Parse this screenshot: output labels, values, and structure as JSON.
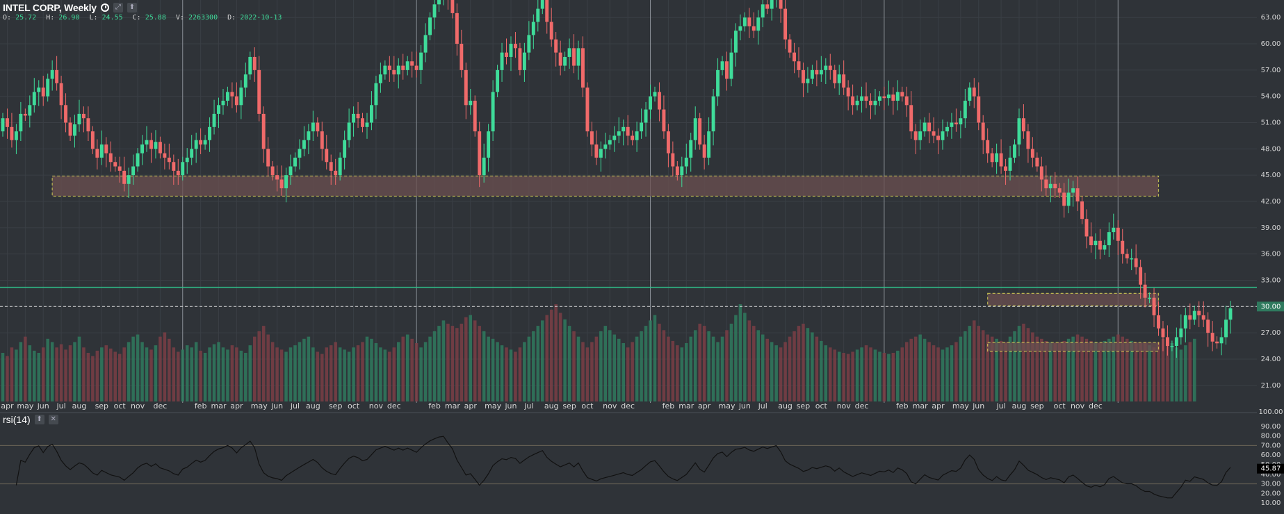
{
  "header": {
    "title": "INTEL CORP, Weekly",
    "ohlc": [
      {
        "label": "O:",
        "value": "25.72"
      },
      {
        "label": "H:",
        "value": "26.90"
      },
      {
        "label": "L:",
        "value": "24.55"
      },
      {
        "label": "C:",
        "value": "25.88"
      },
      {
        "label": "V:",
        "value": "2263300"
      },
      {
        "label": "D:",
        "value": "2022-10-13"
      }
    ],
    "expand_icon": "expand-icon",
    "up_icon": "arrow-up-icon"
  },
  "rsi_header": {
    "title": "rsi(14)",
    "up_icon": "arrow-up-icon",
    "close_icon": "close-icon"
  },
  "colors": {
    "up": "#3fdc9a",
    "down": "#f06a6a",
    "bg": "#2f3338",
    "grid": "#3a3f45",
    "zone": "#6b5050",
    "zone_border": "#e8e05a",
    "hline": "#2fbf8a",
    "rsi_line": "#111111"
  },
  "chart_data": {
    "type": "candlestick",
    "interval": "Weekly",
    "y_ticks": [
      "63.00",
      "60.00",
      "57.00",
      "54.00",
      "51.00",
      "48.00",
      "45.00",
      "42.00",
      "39.00",
      "36.00",
      "33.00",
      "30.00",
      "27.00",
      "24.00",
      "21.00"
    ],
    "y_ticks_values": [
      63,
      60,
      57,
      54,
      51,
      48,
      45,
      42,
      39,
      36,
      33,
      30,
      27,
      24,
      21
    ],
    "ylim": [
      19,
      65
    ],
    "price_marker": "30.00",
    "x_labels": [
      "apr",
      "may",
      "jun",
      "jul",
      "aug",
      "sep",
      "oct",
      "nov",
      "dec",
      "feb",
      "mar",
      "apr",
      "may",
      "jun",
      "jul",
      "aug",
      "sep",
      "oct",
      "nov",
      "dec",
      "feb",
      "mar",
      "apr",
      "may",
      "jun",
      "jul",
      "aug",
      "sep",
      "oct",
      "nov",
      "dec",
      "feb",
      "mar",
      "apr",
      "may",
      "jun",
      "jul",
      "aug",
      "sep",
      "oct",
      "nov",
      "dec",
      "feb",
      "mar",
      "apr",
      "may",
      "jun",
      "jul",
      "aug",
      "sep",
      "oct",
      "nov",
      "dec"
    ],
    "x_label_index": [
      1,
      5,
      9,
      13,
      17,
      22,
      26,
      30,
      35,
      44,
      48,
      52,
      57,
      61,
      65,
      69,
      74,
      78,
      83,
      87,
      96,
      100,
      104,
      109,
      113,
      117,
      122,
      126,
      130,
      135,
      139,
      148,
      152,
      156,
      161,
      165,
      169,
      174,
      178,
      182,
      187,
      191,
      200,
      204,
      208,
      213,
      217,
      222,
      226,
      230,
      235,
      239,
      243
    ],
    "year_separators": [
      40,
      92,
      144,
      196,
      248
    ],
    "support_zones": [
      {
        "low": 42.6,
        "high": 44.9
      },
      {
        "low": 30.1,
        "high": 31.5
      },
      {
        "low": 24.9,
        "high": 25.9
      }
    ],
    "zone_ranges": [
      [
        11,
        257
      ],
      [
        219,
        257
      ],
      [
        219,
        257
      ]
    ],
    "horizontal_line": 32.2,
    "dashed_line": 30.0,
    "closes": [
      51.5,
      50.5,
      49.0,
      50.0,
      52.0,
      51.8,
      53.0,
      54.5,
      55.0,
      54.0,
      56.0,
      57.0,
      55.5,
      53.0,
      51.0,
      49.5,
      50.8,
      52.0,
      51.5,
      50.0,
      48.0,
      47.0,
      48.5,
      47.5,
      46.5,
      46.0,
      45.5,
      44.0,
      45.0,
      46.0,
      47.5,
      48.5,
      49.0,
      48.0,
      48.8,
      47.5,
      47.0,
      46.5,
      45.5,
      45.0,
      46.5,
      47.0,
      48.0,
      49.0,
      48.5,
      49.0,
      50.5,
      52.0,
      53.0,
      53.5,
      54.5,
      54.0,
      53.0,
      55.0,
      56.5,
      58.5,
      57.0,
      52.0,
      48.0,
      46.0,
      45.0,
      44.5,
      43.5,
      45.0,
      46.0,
      47.0,
      48.0,
      49.0,
      50.0,
      51.0,
      50.0,
      48.0,
      46.5,
      45.5,
      45.0,
      47.0,
      49.0,
      51.0,
      52.0,
      51.5,
      50.5,
      51.0,
      53.0,
      55.5,
      56.5,
      57.5,
      57.0,
      56.5,
      57.5,
      57.0,
      58.0,
      57.5,
      57.0,
      59.0,
      61.0,
      63.0,
      64.5,
      66.0,
      66.5,
      65.0,
      63.5,
      60.0,
      57.0,
      53.0,
      53.5,
      50.0,
      45.0,
      47.0,
      50.0,
      54.5,
      57.0,
      59.0,
      58.5,
      60.0,
      59.5,
      57.0,
      59.0,
      61.0,
      62.5,
      64.0,
      65.5,
      62.5,
      60.5,
      59.0,
      57.5,
      58.5,
      59.5,
      57.5,
      59.5,
      55.0,
      50.0,
      48.5,
      47.0,
      48.0,
      48.5,
      49.0,
      49.5,
      50.0,
      50.5,
      49.5,
      49.0,
      50.0,
      51.0,
      52.5,
      54.0,
      54.5,
      52.5,
      50.0,
      47.5,
      46.0,
      45.0,
      46.0,
      47.0,
      49.0,
      51.5,
      48.5,
      47.0,
      50.0,
      54.0,
      57.0,
      58.0,
      56.0,
      59.0,
      61.5,
      62.0,
      63.0,
      62.0,
      61.5,
      63.0,
      64.5,
      64.0,
      65.0,
      66.0,
      64.0,
      60.5,
      59.0,
      58.0,
      57.0,
      55.5,
      56.0,
      57.0,
      56.5,
      57.0,
      57.5,
      57.0,
      55.5,
      56.5,
      55.0,
      54.0,
      53.0,
      53.5,
      54.0,
      53.5,
      53.0,
      53.5,
      54.0,
      53.8,
      54.2,
      53.5,
      54.5,
      54.0,
      53.0,
      50.0,
      49.0,
      50.0,
      51.0,
      50.0,
      49.5,
      49.0,
      50.0,
      50.5,
      51.0,
      50.8,
      51.5,
      53.5,
      55.0,
      54.0,
      51.0,
      49.0,
      47.5,
      46.5,
      47.5,
      46.0,
      45.5,
      47.0,
      48.5,
      51.5,
      50.0,
      48.0,
      47.0,
      46.0,
      44.5,
      43.5,
      44.0,
      43.5,
      43.0,
      41.5,
      43.0,
      43.5,
      42.0,
      40.0,
      38.0,
      37.0,
      37.5,
      36.5,
      37.0,
      38.5,
      39.0,
      37.5,
      36.0,
      35.5,
      35.5,
      34.5,
      32.5,
      31.0,
      31.0,
      29.0,
      27.5,
      26.5,
      25.5,
      25.5,
      26.5,
      27.5,
      29.0,
      28.5,
      29.5,
      29.0,
      28.5,
      27.0,
      26.0,
      25.8,
      26.5,
      28.5,
      29.8
    ],
    "opens": [
      50.0,
      51.5,
      50.5,
      49.0,
      50.0,
      52.0,
      51.8,
      53.0,
      54.5,
      55.0,
      54.0,
      56.0,
      57.0,
      55.5,
      53.0,
      51.0,
      49.5,
      50.8,
      52.0,
      51.5,
      50.0,
      48.0,
      47.0,
      48.5,
      47.5,
      46.5,
      46.0,
      45.5,
      44.0,
      45.0,
      46.0,
      47.5,
      48.5,
      49.0,
      48.0,
      48.8,
      47.5,
      47.0,
      46.5,
      45.5,
      45.0,
      46.5,
      47.0,
      48.0,
      49.0,
      48.5,
      49.0,
      50.5,
      52.0,
      53.0,
      53.5,
      54.5,
      54.0,
      53.0,
      55.0,
      56.5,
      58.5,
      57.0,
      52.0,
      48.0,
      46.0,
      45.0,
      44.5,
      43.5,
      45.0,
      46.0,
      47.0,
      48.0,
      49.0,
      50.0,
      51.0,
      50.0,
      48.0,
      46.5,
      45.5,
      45.0,
      47.0,
      49.0,
      51.0,
      52.0,
      51.5,
      50.5,
      51.0,
      53.0,
      55.5,
      56.5,
      57.5,
      57.0,
      56.5,
      57.5,
      57.0,
      58.0,
      57.5,
      57.0,
      59.0,
      61.0,
      63.0,
      64.5,
      66.0,
      66.5,
      65.0,
      63.5,
      60.0,
      57.0,
      53.0,
      53.5,
      50.0,
      45.0,
      47.0,
      50.0,
      54.5,
      57.0,
      59.0,
      58.5,
      60.0,
      59.5,
      57.0,
      59.0,
      61.0,
      62.5,
      64.0,
      65.5,
      62.5,
      60.5,
      59.0,
      57.5,
      58.5,
      59.5,
      57.5,
      59.5,
      55.0,
      50.0,
      48.5,
      47.0,
      48.0,
      48.5,
      49.0,
      49.5,
      50.0,
      50.5,
      49.5,
      49.0,
      50.0,
      51.0,
      52.5,
      54.0,
      54.5,
      52.5,
      50.0,
      47.5,
      46.0,
      45.0,
      46.0,
      47.0,
      49.0,
      51.5,
      48.5,
      47.0,
      50.0,
      54.0,
      57.0,
      58.0,
      56.0,
      59.0,
      61.5,
      62.0,
      63.0,
      62.0,
      61.5,
      63.0,
      64.5,
      64.0,
      65.0,
      66.0,
      64.0,
      60.5,
      59.0,
      58.0,
      57.0,
      55.5,
      56.0,
      57.0,
      56.5,
      57.0,
      57.5,
      57.0,
      55.5,
      56.5,
      55.0,
      54.0,
      53.0,
      53.5,
      54.0,
      53.5,
      53.0,
      53.5,
      54.0,
      53.8,
      54.2,
      53.5,
      54.5,
      54.0,
      53.0,
      50.0,
      49.0,
      50.0,
      51.0,
      50.0,
      49.5,
      49.0,
      50.0,
      50.5,
      51.0,
      50.8,
      51.5,
      53.5,
      55.0,
      54.0,
      51.0,
      49.0,
      47.5,
      46.5,
      47.5,
      46.0,
      45.5,
      47.0,
      48.5,
      51.5,
      50.0,
      48.0,
      47.0,
      46.0,
      44.5,
      43.5,
      44.0,
      43.5,
      43.0,
      41.5,
      43.0,
      43.5,
      42.0,
      40.0,
      38.0,
      37.0,
      37.5,
      36.5,
      37.0,
      38.5,
      39.0,
      37.5,
      36.0,
      35.5,
      35.5,
      34.5,
      32.5,
      31.0,
      31.0,
      29.0,
      27.5,
      26.5,
      25.5,
      25.5,
      26.5,
      27.5,
      29.0,
      28.5,
      29.5,
      29.0,
      28.5,
      27.0,
      26.0,
      25.8,
      26.5,
      28.5
    ],
    "volumes": [
      0.45,
      0.42,
      0.5,
      0.48,
      0.55,
      0.6,
      0.52,
      0.47,
      0.45,
      0.5,
      0.58,
      0.55,
      0.5,
      0.53,
      0.48,
      0.52,
      0.55,
      0.6,
      0.5,
      0.45,
      0.42,
      0.47,
      0.5,
      0.52,
      0.49,
      0.46,
      0.44,
      0.5,
      0.55,
      0.6,
      0.62,
      0.55,
      0.5,
      0.48,
      0.52,
      0.6,
      0.64,
      0.58,
      0.5,
      0.46,
      0.48,
      0.52,
      0.5,
      0.55,
      0.47,
      0.45,
      0.5,
      0.53,
      0.55,
      0.5,
      0.48,
      0.52,
      0.5,
      0.47,
      0.45,
      0.52,
      0.6,
      0.65,
      0.7,
      0.62,
      0.55,
      0.5,
      0.48,
      0.46,
      0.5,
      0.52,
      0.55,
      0.58,
      0.6,
      0.5,
      0.46,
      0.44,
      0.5,
      0.52,
      0.55,
      0.5,
      0.48,
      0.46,
      0.5,
      0.52,
      0.55,
      0.6,
      0.58,
      0.54,
      0.5,
      0.48,
      0.46,
      0.5,
      0.55,
      0.6,
      0.62,
      0.58,
      0.54,
      0.5,
      0.55,
      0.6,
      0.65,
      0.7,
      0.75,
      0.72,
      0.7,
      0.68,
      0.72,
      0.78,
      0.8,
      0.75,
      0.7,
      0.65,
      0.6,
      0.58,
      0.55,
      0.52,
      0.5,
      0.48,
      0.46,
      0.5,
      0.55,
      0.6,
      0.65,
      0.7,
      0.75,
      0.8,
      0.85,
      0.9,
      0.82,
      0.76,
      0.7,
      0.65,
      0.6,
      0.55,
      0.5,
      0.55,
      0.6,
      0.65,
      0.7,
      0.66,
      0.62,
      0.58,
      0.54,
      0.5,
      0.55,
      0.6,
      0.65,
      0.7,
      0.75,
      0.8,
      0.72,
      0.66,
      0.6,
      0.56,
      0.52,
      0.5,
      0.54,
      0.6,
      0.66,
      0.72,
      0.7,
      0.65,
      0.6,
      0.55,
      0.6,
      0.66,
      0.72,
      0.8,
      0.9,
      0.82,
      0.75,
      0.7,
      0.66,
      0.62,
      0.58,
      0.55,
      0.52,
      0.5,
      0.55,
      0.6,
      0.65,
      0.7,
      0.72,
      0.68,
      0.64,
      0.6,
      0.56,
      0.52,
      0.5,
      0.48,
      0.46,
      0.45,
      0.44,
      0.46,
      0.48,
      0.5,
      0.52,
      0.5,
      0.48,
      0.46,
      0.45,
      0.44,
      0.45,
      0.47,
      0.5,
      0.55,
      0.58,
      0.6,
      0.62,
      0.58,
      0.55,
      0.52,
      0.5,
      0.48,
      0.5,
      0.52,
      0.55,
      0.6,
      0.65,
      0.7,
      0.75,
      0.7,
      0.66,
      0.62,
      0.6,
      0.58,
      0.56,
      0.55,
      0.6,
      0.65,
      0.7,
      0.72,
      0.68,
      0.64,
      0.6,
      0.58,
      0.56,
      0.55,
      0.54,
      0.55,
      0.56,
      0.58,
      0.6,
      0.62,
      0.6,
      0.58,
      0.56,
      0.55,
      0.54,
      0.56,
      0.58,
      0.6,
      0.62,
      0.6,
      0.58,
      0.56,
      0.55,
      0.54,
      0.55,
      0.52,
      0.5,
      0.55,
      0.58,
      0.56,
      0.54,
      0.5,
      0.48,
      0.52,
      0.55,
      0.58
    ],
    "rsi": {
      "label": "rsi(14)",
      "y_ticks": [
        "90.00",
        "80.00",
        "70.00",
        "60.00",
        "50.00",
        "40.00",
        "30.00",
        "20.00",
        "10.00"
      ],
      "y_ticks_values": [
        90,
        80,
        70,
        60,
        50,
        40,
        30,
        20,
        10
      ],
      "ylim": [
        0,
        100
      ],
      "top_label": "100.00",
      "current": "45.87",
      "bands": [
        30,
        70
      ]
    }
  }
}
